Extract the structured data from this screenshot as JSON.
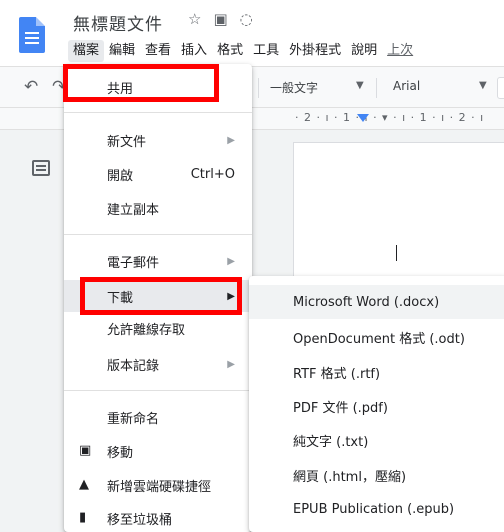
{
  "app": {
    "title": "無標題文件",
    "title_icons": [
      "star-icon",
      "folder-icon",
      "cloud-icon"
    ]
  },
  "menubar": {
    "items": [
      "檔案",
      "編輯",
      "查看",
      "插入",
      "格式",
      "工具",
      "外掛程式",
      "說明",
      "上次"
    ],
    "active_index": 0
  },
  "toolbar": {
    "style_value": "一般文字",
    "font_value": "Arial"
  },
  "ruler": {
    "text": "· 2 · ı · 1 · ı · ▾ · ı · 1 · ı · 2 · ı"
  },
  "file_menu": {
    "items": [
      {
        "label": "共用"
      },
      {
        "label": "新文件",
        "arrow": "▶"
      },
      {
        "label": "開啟",
        "shortcut": "Ctrl+O"
      },
      {
        "label": "建立副本"
      },
      {
        "label": "電子郵件",
        "arrow": "▶"
      },
      {
        "label": "下載",
        "arrow": "▶"
      },
      {
        "label": "允許離線存取"
      },
      {
        "label": "版本記錄",
        "arrow": "▶"
      },
      {
        "label": "重新命名"
      },
      {
        "label": "移動"
      },
      {
        "label": "新增雲端硬碟捷徑"
      },
      {
        "label": "移至垃圾桶"
      }
    ]
  },
  "download_submenu": {
    "items": [
      {
        "label": "Microsoft Word (.docx)"
      },
      {
        "label": "OpenDocument 格式 (.odt)"
      },
      {
        "label": "RTF 格式 (.rtf)"
      },
      {
        "label": "PDF 文件 (.pdf)"
      },
      {
        "label": "純文字 (.txt)"
      },
      {
        "label": "網頁 (.html，壓縮)"
      },
      {
        "label": "EPUB Publication (.epub)"
      }
    ]
  },
  "colors": {
    "highlight": "#ff0000",
    "docs_blue": "#4285f4"
  }
}
